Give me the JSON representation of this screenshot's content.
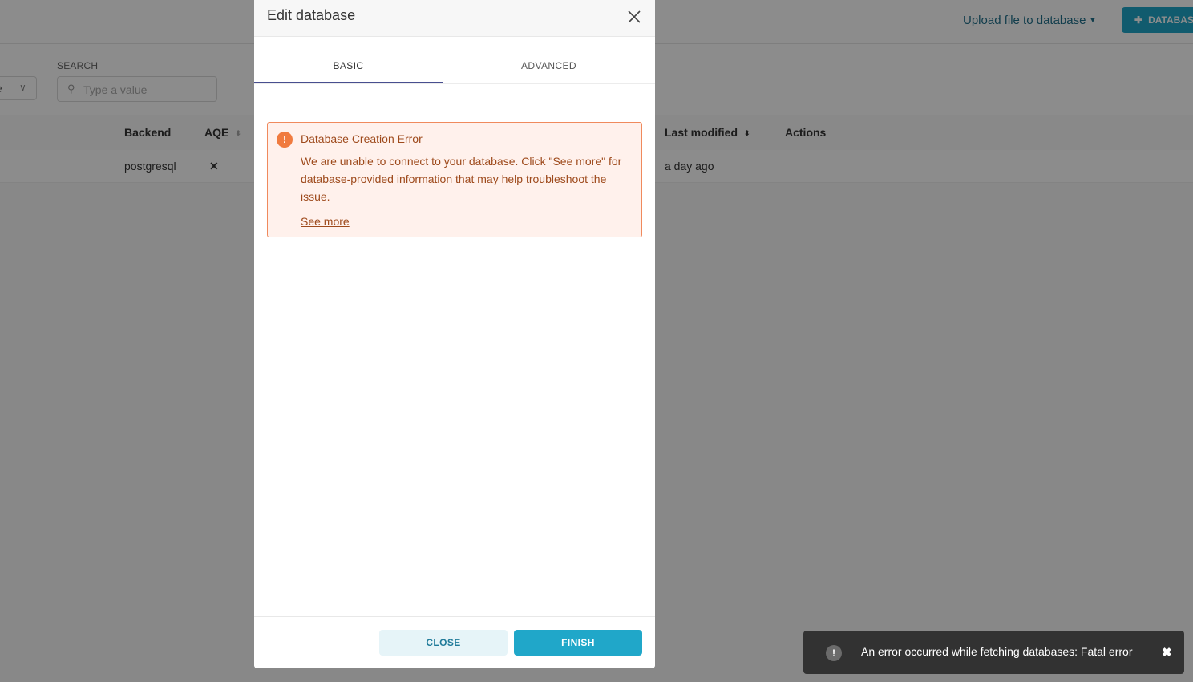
{
  "background": {
    "upload_link": "Upload file to database",
    "add_database_button": "DATABASE",
    "filter_select_value": "e",
    "search": {
      "label": "SEARCH",
      "placeholder": "Type a value"
    },
    "table": {
      "columns": [
        "Backend",
        "AQE",
        "Last modified",
        "Actions"
      ],
      "rows": [
        {
          "backend": "postgresql",
          "aqe": "✕",
          "last_modified": "a day ago"
        }
      ]
    }
  },
  "modal": {
    "title": "Edit database",
    "tabs": [
      {
        "label": "BASIC",
        "active": true
      },
      {
        "label": "ADVANCED",
        "active": false
      }
    ],
    "alert": {
      "title": "Database Creation Error",
      "body": "We are unable to connect to your database. Click \"See more\" for database-provided information that may help troubleshoot the issue.",
      "link": "See more"
    },
    "footer": {
      "close_label": "CLOSE",
      "finish_label": "FINISH"
    }
  },
  "toast": {
    "message": "An error occurred while fetching databases: Fatal error"
  },
  "colors": {
    "primary": "#20a7c9",
    "alert_border": "#f08a5d",
    "alert_bg": "#fff1ec",
    "tab_active": "#484e8f"
  }
}
